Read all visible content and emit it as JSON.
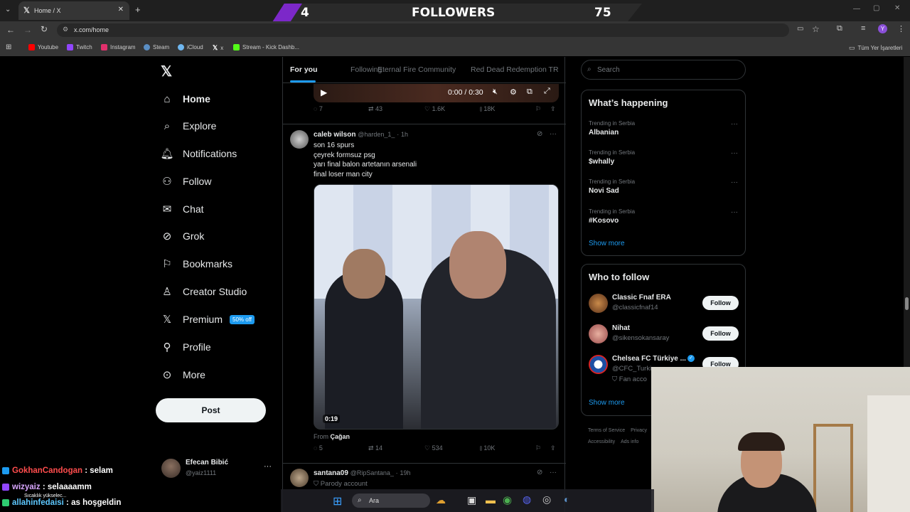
{
  "browser": {
    "tab_title": "Home / X",
    "url": "x.com/home",
    "bookmarks": [
      "Youtube",
      "Twitch",
      "Instagram",
      "Steam",
      "iCloud",
      "x",
      "Stream - Kick Dashb..."
    ],
    "all_bookmarks": "Tüm Yer İşaretleri",
    "profile_initial": "Y"
  },
  "overlay": {
    "left_count": "4",
    "label": "FOLLOWERS",
    "right_count": "75"
  },
  "nav": {
    "items": [
      "Home",
      "Explore",
      "Notifications",
      "Follow",
      "Chat",
      "Grok",
      "Bookmarks",
      "Creator Studio",
      "Premium",
      "Profile",
      "More"
    ],
    "premium_badge": "50% off",
    "post_button": "Post",
    "account_name": "Efecan Bibić",
    "account_handle": "@yaiz1111"
  },
  "feed": {
    "tabs": [
      "For you",
      "Following",
      "Eternal Fire Community",
      "Red Dead Redemption TR"
    ],
    "prev_video_time": "0:00 / 0:30",
    "prev_actions": {
      "replies": "7",
      "reposts": "43",
      "likes": "1.6K",
      "views": "18K"
    },
    "tweet": {
      "name": "caleb wilson",
      "handle": "@harden_1_",
      "time": "1h",
      "lines": [
        "son 16 spurs",
        "çeyrek formsuz psg",
        "yarı final balon artetanın arsenali",
        "final loser man city"
      ],
      "video_duration": "0:19",
      "from_label": "From",
      "from_name": "Çağan",
      "actions": {
        "replies": "5",
        "reposts": "14",
        "likes": "534",
        "views": "10K"
      }
    },
    "next_tweet": {
      "name": "santana09",
      "handle": "@RipSantana_",
      "time": "19h",
      "label": "Parody account"
    }
  },
  "right": {
    "search_placeholder": "Search",
    "whats_happening": "What’s happening",
    "trends": [
      {
        "category": "Trending in Serbia",
        "name": "Albanian"
      },
      {
        "category": "Trending in Serbia",
        "name": "$whally"
      },
      {
        "category": "Trending in Serbia",
        "name": "Novi Sad"
      },
      {
        "category": "Trending in Serbia",
        "name": "#Kosovo"
      }
    ],
    "show_more": "Show more",
    "who_to_follow": "Who to follow",
    "suggestions": [
      {
        "name": "Classic Fnaf ERA",
        "handle": "@classicfnaf14"
      },
      {
        "name": "Nihat",
        "handle": "@sikensokansaray"
      },
      {
        "name": "Chelsea FC Türkiye ...",
        "handle": "@CFC_Turkiy",
        "extra": "Fan acco"
      }
    ],
    "follow_label": "Follow",
    "footer": [
      "Terms of Service",
      "Privacy",
      "Accessibility",
      "Ads info"
    ]
  },
  "chat": [
    {
      "user": "GokhanCandogan",
      "msg": " : selam",
      "color": "#ff4d4d"
    },
    {
      "user": "wizyaiz",
      "msg": " : selaaaamm",
      "color": "#d9a7ff"
    },
    {
      "user": "allahinfedaisi",
      "msg": " : as hoşgeldin",
      "color": "#5ec8ff"
    }
  ],
  "taskbar": {
    "search": "Ara",
    "weather": "Sıcaklık yükselec..."
  }
}
